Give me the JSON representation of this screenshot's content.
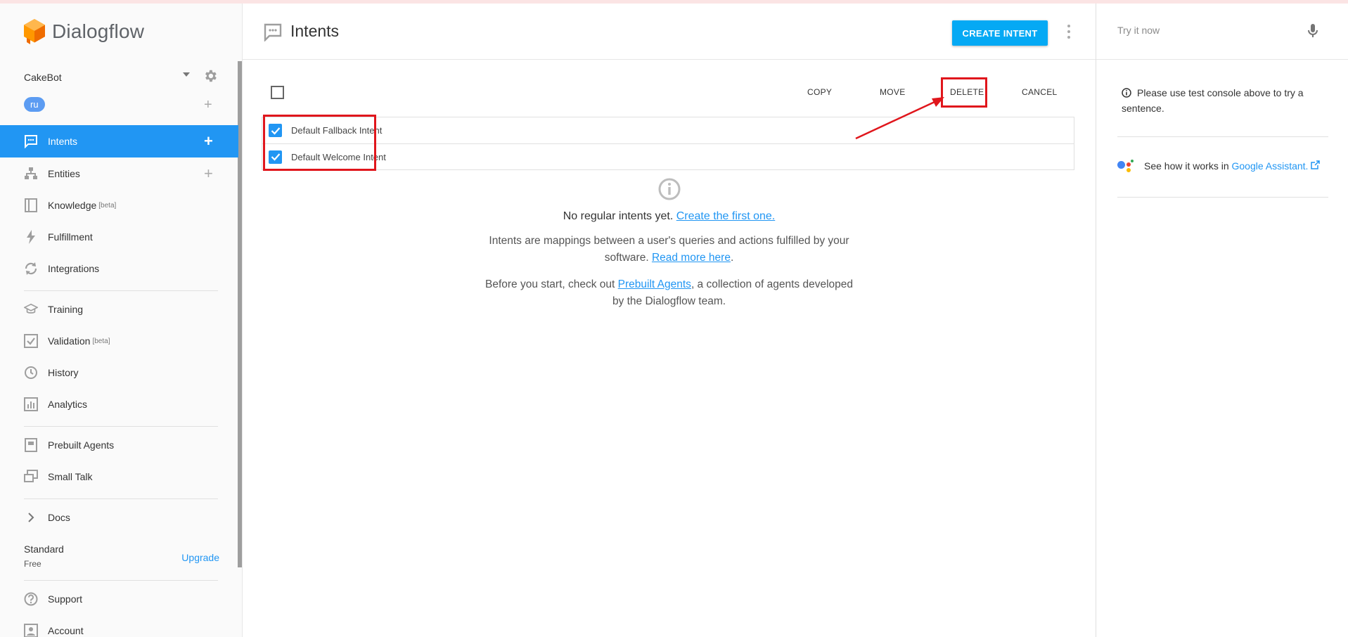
{
  "app": {
    "name": "Dialogflow"
  },
  "agent": {
    "name": "CakeBot",
    "language": "ru"
  },
  "sidebar": {
    "items": [
      {
        "label": "Intents",
        "icon": "chat-bubble-icon",
        "active": true,
        "has_add": true
      },
      {
        "label": "Entities",
        "icon": "hierarchy-icon",
        "has_add": true
      },
      {
        "label": "Knowledge",
        "icon": "book-icon",
        "badge": "[beta]"
      },
      {
        "label": "Fulfillment",
        "icon": "bolt-icon"
      },
      {
        "label": "Integrations",
        "icon": "sync-icon"
      },
      {
        "label": "Training",
        "icon": "graduation-cap-icon"
      },
      {
        "label": "Validation",
        "icon": "check-square-icon",
        "badge": "[beta]"
      },
      {
        "label": "History",
        "icon": "clock-icon"
      },
      {
        "label": "Analytics",
        "icon": "bar-chart-icon"
      },
      {
        "label": "Prebuilt Agents",
        "icon": "agent-book-icon"
      },
      {
        "label": "Small Talk",
        "icon": "small-talk-icon"
      },
      {
        "label": "Docs",
        "icon": "chevron-right-icon"
      },
      {
        "label": "Support",
        "icon": "question-icon"
      },
      {
        "label": "Account",
        "icon": "account-icon"
      }
    ],
    "plan": {
      "name": "Standard",
      "tier": "Free",
      "upgrade_label": "Upgrade"
    }
  },
  "header": {
    "title": "Intents",
    "create_label": "CREATE INTENT"
  },
  "toolbar": {
    "copy_label": "COPY",
    "move_label": "MOVE",
    "delete_label": "DELETE",
    "cancel_label": "CANCEL"
  },
  "intents": [
    {
      "name": "Default Fallback Intent",
      "checked": true
    },
    {
      "name": "Default Welcome Intent",
      "checked": true
    }
  ],
  "empty_state": {
    "title_prefix": "No regular intents yet.",
    "title_link": "Create the first one.",
    "desc1_prefix": "Intents are mappings between a user's queries and actions fulfilled by your software.",
    "desc1_link": "Read more here",
    "desc1_suffix": ".",
    "desc2_prefix": "Before you start, check out",
    "desc2_link": "Prebuilt Agents",
    "desc2_suffix": ", a collection of agents developed by the Dialogflow team."
  },
  "console": {
    "placeholder": "Try it now",
    "info_text": "Please use test console above to try a sentence.",
    "ga_prefix": "See how it works in",
    "ga_link": "Google Assistant."
  },
  "colors": {
    "accent": "#2196f3",
    "create_button": "#05a9f4",
    "highlight": "#e0161c",
    "logo": "#ff9800"
  }
}
